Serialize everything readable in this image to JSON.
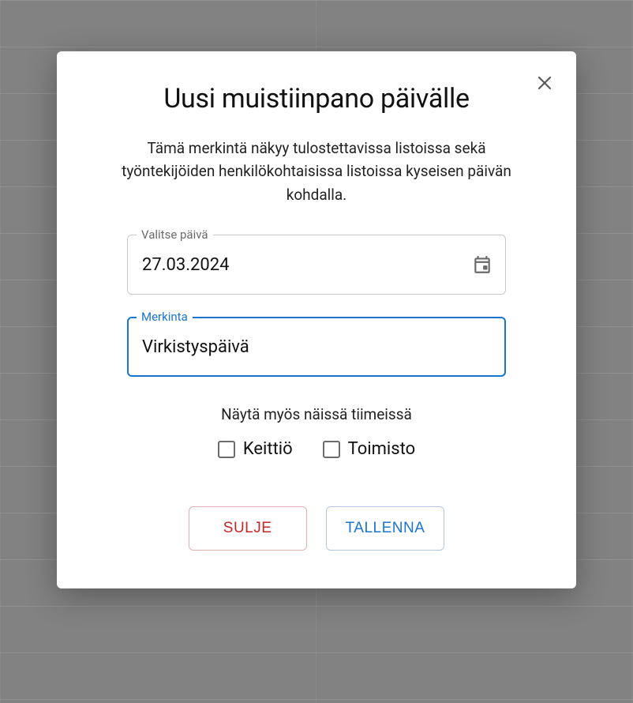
{
  "modal": {
    "title": "Uusi muistiinpano päivälle",
    "description": "Tämä merkintä näkyy tulostettavissa listoissa sekä työntekijöiden henkilökohtaisissa listoissa kyseisen päivän kohdalla.",
    "date_field": {
      "label": "Valitse päivä",
      "value": "27.03.2024"
    },
    "note_field": {
      "label": "Merkinta",
      "value": "Virkistyspäivä"
    },
    "teams_label": "Näytä myös näissä tiimeissä",
    "teams": [
      {
        "label": "Keittiö",
        "checked": false
      },
      {
        "label": "Toimisto",
        "checked": false
      }
    ],
    "buttons": {
      "close": "SULJE",
      "save": "TALLENNA"
    }
  }
}
